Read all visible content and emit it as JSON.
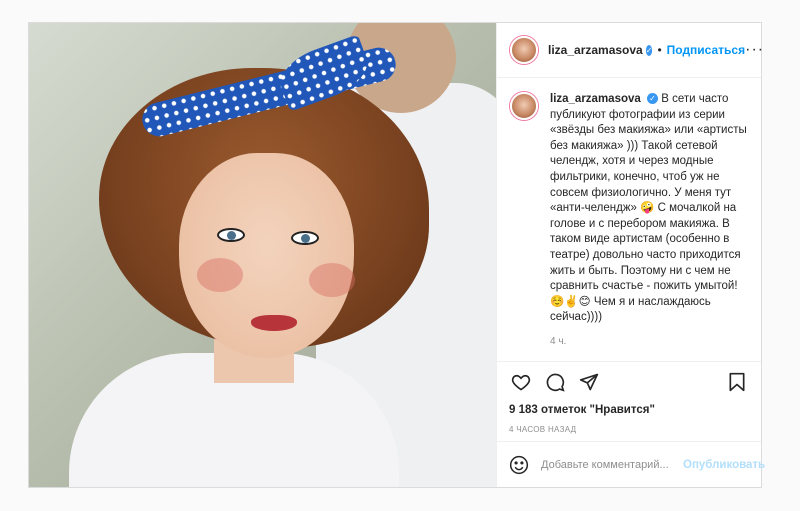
{
  "post": {
    "username": "liza_arzamasova",
    "verified_icon": "verified-badge-icon",
    "separator": "•",
    "follow_label": "Подписаться",
    "more_label": "···",
    "caption_text": "В сети часто публикуют фотографии из серии «звёзды без макияжа» или «артисты без макияжа» ))) Такой сетевой челендж, хотя и через модные фильтрики, конечно, чтоб уж не совсем физиологично. У меня тут «анти-челендж» 🤪 С мочалкой на голове и с перебором макияжа. В таком виде артистам (особенно в театре) довольно часто приходится жить и быть. Поэтому ни с чем не сравнить счастье - пожить умытой! ☺️✌️😊 Чем я и наслаждаюсь сейчас))))",
    "caption_time": "4 ч.",
    "likes": "9 183 отметок \"Нравится\"",
    "posted_ago": "4 ЧАСОВ НАЗАД",
    "comment_placeholder": "Добавьте комментарий...",
    "publish_label": "Опубликовать"
  },
  "colors": {
    "accent": "#0095f6",
    "publish_disabled": "#b2dffc",
    "border": "#dbdbdb",
    "background": "#fafafa"
  },
  "icons": [
    "heart-icon",
    "comment-icon",
    "share-icon",
    "bookmark-icon",
    "emoji-icon",
    "plus-circle-icon",
    "more-icon"
  ]
}
